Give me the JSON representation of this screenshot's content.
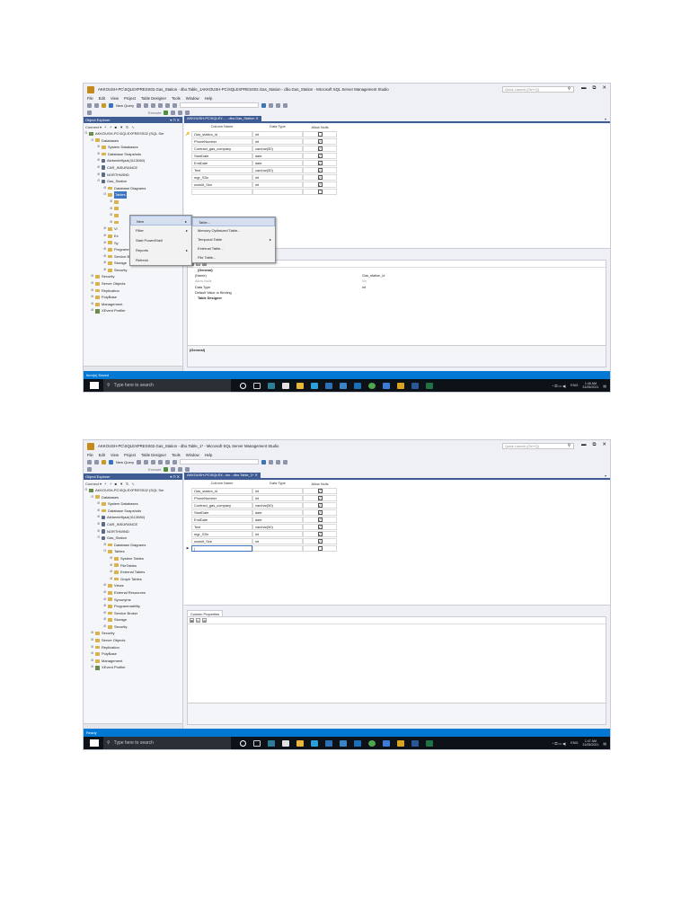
{
  "shot1": {
    "window_title": "AKKOUSH-PC\\SQLEXPRESS02.Gas_Station - dbo.Table_1AKKOUSH-PC\\SQLEXPRESS02.Gas_Station - dbo.Gas_Station - Microsoft SQL Server Management Studio",
    "quick_launch": "Quick Launch (Ctrl+Q)",
    "menu": [
      "File",
      "Edit",
      "View",
      "Project",
      "Table Designer",
      "Tools",
      "Window",
      "Help"
    ],
    "new_query": "New Query",
    "execute": "Execute",
    "oe_title": "Object Explorer",
    "oe_connect": "Connect ▾",
    "tree": [
      {
        "t": "AKKOUSH-PC\\SQLEXPRESS02 (SQL Ser",
        "i": "srv",
        "d": 0,
        "e": "⊟"
      },
      {
        "t": "Databases",
        "i": "folder",
        "d": 1,
        "e": "⊟"
      },
      {
        "t": "System Databases",
        "i": "folder",
        "d": 2,
        "e": "⊞"
      },
      {
        "t": "Database Snapshots",
        "i": "folder",
        "d": 2,
        "e": "⊞"
      },
      {
        "t": "AlebeekHijazi(4113080)",
        "i": "db",
        "d": 2,
        "e": "⊞"
      },
      {
        "t": "CAR_INSURANCE",
        "i": "db",
        "d": 2,
        "e": "⊞"
      },
      {
        "t": "NORTHWIND",
        "i": "db",
        "d": 2,
        "e": "⊞"
      },
      {
        "t": "Gas_Station",
        "i": "db",
        "d": 2,
        "e": "⊟"
      },
      {
        "t": "Database Diagrams",
        "i": "folder",
        "d": 3,
        "e": "⊞"
      },
      {
        "t": "Tables",
        "i": "folder",
        "d": 3,
        "e": "⊟",
        "hl": true
      },
      {
        "t": "",
        "i": "folder",
        "d": 4,
        "e": "⊞"
      },
      {
        "t": "",
        "i": "folder",
        "d": 4,
        "e": "⊞"
      },
      {
        "t": "",
        "i": "folder",
        "d": 4,
        "e": "⊞"
      },
      {
        "t": "",
        "i": "folder",
        "d": 4,
        "e": "⊞"
      },
      {
        "t": "Vi",
        "i": "folder",
        "d": 3,
        "e": "⊞"
      },
      {
        "t": "Ex",
        "i": "folder",
        "d": 3,
        "e": "⊞"
      },
      {
        "t": "Sy",
        "i": "folder",
        "d": 3,
        "e": "⊞"
      },
      {
        "t": "Programmability",
        "i": "folder",
        "d": 3,
        "e": "⊞"
      },
      {
        "t": "Service Broker",
        "i": "folder",
        "d": 3,
        "e": "⊞"
      },
      {
        "t": "Storage",
        "i": "folder",
        "d": 3,
        "e": "⊞"
      },
      {
        "t": "Security",
        "i": "folder",
        "d": 3,
        "e": "⊞"
      },
      {
        "t": "Security",
        "i": "folder",
        "d": 1,
        "e": "⊞"
      },
      {
        "t": "Server Objects",
        "i": "folder",
        "d": 1,
        "e": "⊞"
      },
      {
        "t": "Replication",
        "i": "folder",
        "d": 1,
        "e": "⊞"
      },
      {
        "t": "PolyBase",
        "i": "folder",
        "d": 1,
        "e": "⊞"
      },
      {
        "t": "Management",
        "i": "folder",
        "d": 1,
        "e": "⊞"
      },
      {
        "t": "XEvent Profiler",
        "i": "srv",
        "d": 1,
        "e": "⊞"
      }
    ],
    "tab_label": "AKKOUSH-PC\\SQLEX... - dbo.Gas_Station  ✕",
    "headers": [
      "Column Name",
      "Data Type",
      "Allow Nulls"
    ],
    "rows": [
      {
        "n": "Gas_station_id",
        "t": "int",
        "c": "",
        "m": "🔑"
      },
      {
        "n": "PhoneNumber",
        "t": "int",
        "c": "✓",
        "m": ""
      },
      {
        "n": "Contract_gas_company",
        "t": "varchar(50)",
        "c": "✓",
        "m": ""
      },
      {
        "n": "StartDate",
        "t": "date",
        "c": "✓",
        "m": ""
      },
      {
        "n": "EndDate",
        "t": "date",
        "c": "✓",
        "m": ""
      },
      {
        "n": "Text",
        "t": "varchar(50)",
        "c": "✓",
        "m": ""
      },
      {
        "n": "mgr_SSn",
        "t": "int",
        "c": "✓",
        "m": ""
      },
      {
        "n": "worklit_Ssn",
        "t": "int",
        "c": "✓",
        "m": ""
      },
      {
        "n": "",
        "t": "",
        "c": "",
        "m": ""
      }
    ],
    "menu1": [
      {
        "l": "New",
        "a": "▸",
        "on": true
      },
      {
        "l": "Filter",
        "a": "▸"
      },
      {
        "l": "Start PowerShell",
        "a": ""
      },
      {
        "l": "Reports",
        "a": "▸"
      },
      {
        "l": "Refresh",
        "a": ""
      }
    ],
    "menu2": [
      {
        "l": "Table...",
        "on": true
      },
      {
        "l": "Memory Optimized Table..."
      },
      {
        "l": "Temporal Table",
        "a": "▸"
      },
      {
        "l": "External Table..."
      },
      {
        "l": "File Table..."
      }
    ],
    "cp_title": "Column Properties",
    "props": [
      {
        "k": "(General)",
        "v": "",
        "cat": true
      },
      {
        "k": "(Name)",
        "v": "Gas_station_id"
      },
      {
        "k": "Allow Nulls",
        "v": "No",
        "gray": true
      },
      {
        "k": "Data Type",
        "v": "int"
      },
      {
        "k": "Default Value or Binding",
        "v": ""
      },
      {
        "k": "Table Designer",
        "v": "",
        "cat": true
      }
    ],
    "cp_desc": "(General)",
    "status": "Item(s) Saved",
    "search": "Type here to search",
    "lang": "ENG",
    "time": "1:48 AM",
    "date": "31/05/2021"
  },
  "shot2": {
    "window_title": "AKKOUSH-PC\\SQLEXPRESS02.Gas_Station - dbo.Table_1* - Microsoft SQL Server Management Studio",
    "quick_launch": "Quick Launch (Ctrl+Q)",
    "menu": [
      "File",
      "Edit",
      "View",
      "Project",
      "Table Designer",
      "Tools",
      "Window",
      "Help"
    ],
    "new_query": "New Query",
    "execute": "Execute",
    "oe_title": "Object Explorer",
    "oe_connect": "Connect ▾",
    "tree": [
      {
        "t": "AKKOUSH-PC\\SQLEXPRESS02 (SQL Ser",
        "i": "srv",
        "d": 0,
        "e": "⊟"
      },
      {
        "t": "Databases",
        "i": "folder",
        "d": 1,
        "e": "⊟"
      },
      {
        "t": "System Databases",
        "i": "folder",
        "d": 2,
        "e": "⊞"
      },
      {
        "t": "Database Snapshots",
        "i": "folder",
        "d": 2,
        "e": "⊞"
      },
      {
        "t": "AlebeekHijazi(4113080)",
        "i": "db",
        "d": 2,
        "e": "⊞"
      },
      {
        "t": "CAR_INSURANCE",
        "i": "db",
        "d": 2,
        "e": "⊞"
      },
      {
        "t": "NORTHWIND",
        "i": "db",
        "d": 2,
        "e": "⊞"
      },
      {
        "t": "Gas_Station",
        "i": "db",
        "d": 2,
        "e": "⊟"
      },
      {
        "t": "Database Diagrams",
        "i": "folder",
        "d": 3,
        "e": "⊞"
      },
      {
        "t": "Tables",
        "i": "folder",
        "d": 3,
        "e": "⊟"
      },
      {
        "t": "System Tables",
        "i": "folder",
        "d": 4,
        "e": "⊞"
      },
      {
        "t": "FileTables",
        "i": "folder",
        "d": 4,
        "e": "⊞"
      },
      {
        "t": "External Tables",
        "i": "folder",
        "d": 4,
        "e": "⊞"
      },
      {
        "t": "Graph Tables",
        "i": "folder",
        "d": 4,
        "e": "⊞"
      },
      {
        "t": "Views",
        "i": "folder",
        "d": 3,
        "e": "⊞"
      },
      {
        "t": "External Resources",
        "i": "folder",
        "d": 3,
        "e": "⊞"
      },
      {
        "t": "Synonyms",
        "i": "folder",
        "d": 3,
        "e": "⊞"
      },
      {
        "t": "Programmability",
        "i": "folder",
        "d": 3,
        "e": "⊞"
      },
      {
        "t": "Service Broker",
        "i": "folder",
        "d": 3,
        "e": "⊞"
      },
      {
        "t": "Storage",
        "i": "folder",
        "d": 3,
        "e": "⊞"
      },
      {
        "t": "Security",
        "i": "folder",
        "d": 3,
        "e": "⊞"
      },
      {
        "t": "Security",
        "i": "folder",
        "d": 1,
        "e": "⊞"
      },
      {
        "t": "Server Objects",
        "i": "folder",
        "d": 1,
        "e": "⊞"
      },
      {
        "t": "Replication",
        "i": "folder",
        "d": 1,
        "e": "⊞"
      },
      {
        "t": "PolyBase",
        "i": "folder",
        "d": 1,
        "e": "⊞"
      },
      {
        "t": "Management",
        "i": "folder",
        "d": 1,
        "e": "⊞"
      },
      {
        "t": "XEvent Profiler",
        "i": "srv",
        "d": 1,
        "e": "⊞"
      }
    ],
    "tab_label": "AKKOUSH-PC\\SQLEX...ion - dbo.Table_1*  ✕",
    "headers": [
      "Column Name",
      "Data Type",
      "Allow Nulls"
    ],
    "rows": [
      {
        "n": "Gas_station_id",
        "t": "int",
        "c": "✓",
        "m": ""
      },
      {
        "n": "PhoneNumber",
        "t": "int",
        "c": "✓",
        "m": ""
      },
      {
        "n": "Contract_gas_company",
        "t": "varchar(50)",
        "c": "✓",
        "m": ""
      },
      {
        "n": "StartDate",
        "t": "date",
        "c": "✓",
        "m": ""
      },
      {
        "n": "EndDate",
        "t": "date",
        "c": "✓",
        "m": ""
      },
      {
        "n": "Text",
        "t": "varchar(50)",
        "c": "✓",
        "m": ""
      },
      {
        "n": "mgr_SSn",
        "t": "int",
        "c": "✓",
        "m": ""
      },
      {
        "n": "worklit_Sce",
        "t": "int",
        "c": "✓",
        "m": ""
      },
      {
        "n": "|",
        "t": "",
        "c": "",
        "m": "▶",
        "newrow": true
      }
    ],
    "cp_title": "Column Properties",
    "props": [],
    "cp_desc": "",
    "status": "Ready",
    "search": "Type here to search",
    "lang": "ENG",
    "time": "1:47 AM",
    "date": "31/05/2021"
  },
  "colors": {
    "accent": "#3f5b93",
    "status_bar": "#0078d4",
    "taskbar": "#0d1218"
  }
}
